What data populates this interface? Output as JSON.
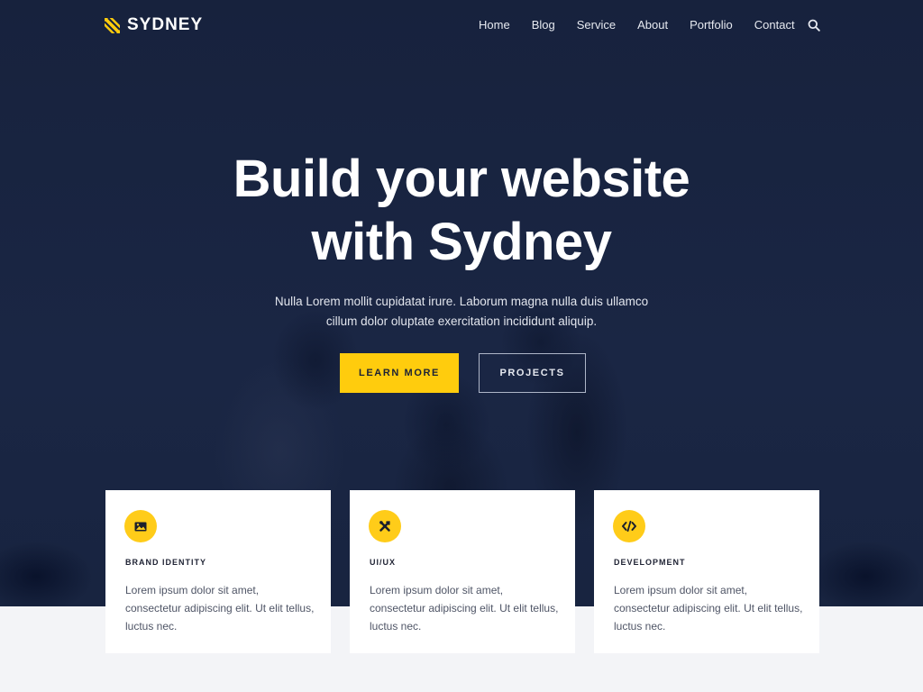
{
  "brand": {
    "name": "SYDNEY",
    "accent_color": "#ffcc0d",
    "dark_color": "#17233f"
  },
  "nav": {
    "items": [
      {
        "label": "Home"
      },
      {
        "label": "Blog"
      },
      {
        "label": "Service"
      },
      {
        "label": "About"
      },
      {
        "label": "Portfolio"
      },
      {
        "label": "Contact"
      }
    ],
    "search_icon": "search-icon"
  },
  "hero": {
    "title_line1": "Build your website",
    "title_line2": "with Sydney",
    "subtitle": "Nulla Lorem mollit cupidatat irure. Laborum magna nulla duis ullamco cillum dolor oluptate exercitation incididunt aliquip.",
    "primary_button": "LEARN MORE",
    "secondary_button": "PROJECTS"
  },
  "services": [
    {
      "icon": "image-icon",
      "title": "BRAND IDENTITY",
      "text": "Lorem ipsum dolor sit amet, consectetur adipiscing elit. Ut elit tellus, luctus nec."
    },
    {
      "icon": "design-tools-icon",
      "title": "UI/UX",
      "text": "Lorem ipsum dolor sit amet, consectetur adipiscing elit. Ut elit tellus, luctus nec."
    },
    {
      "icon": "code-icon",
      "title": "DEVELOPMENT",
      "text": "Lorem ipsum dolor sit amet, consectetur adipiscing elit. Ut elit tellus, luctus nec."
    }
  ]
}
